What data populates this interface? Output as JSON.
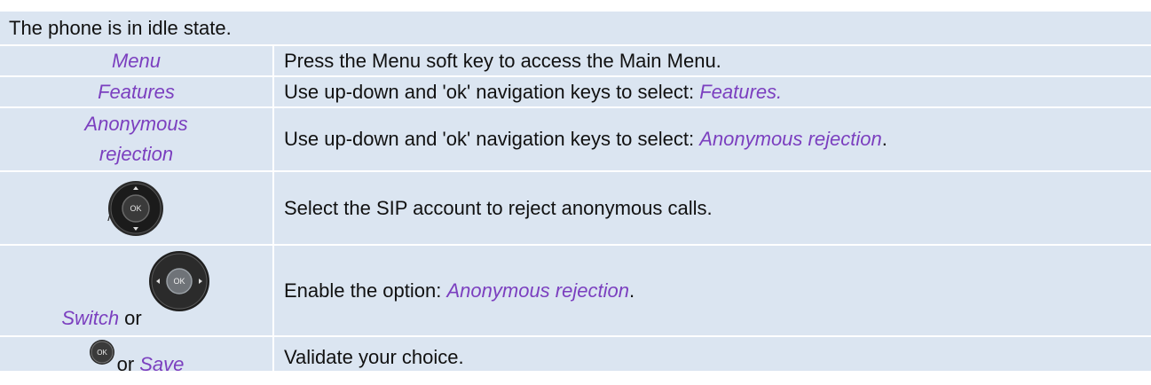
{
  "header": {
    "text": "The phone is in idle state."
  },
  "rows": [
    {
      "left": {
        "label": "Menu"
      },
      "right": {
        "text": "Press the Menu soft key to access the Main Menu."
      }
    },
    {
      "left": {
        "label": "Features"
      },
      "right": {
        "prefix": "Use up-down and 'ok' navigation keys to select:",
        "highlight": "Features."
      }
    },
    {
      "left": {
        "label_line1": "Anonymous",
        "label_line2": "rejection"
      },
      "right": {
        "prefix": "Use up-down and 'ok' navigation keys to select:",
        "highlight": "Anonymous rejection",
        "suffix": "."
      }
    },
    {
      "left": {
        "icon": "up-down-ok-navigation-key-icon",
        "slash": "/",
        "ok_text": "OK"
      },
      "right": {
        "text": "Select the SIP account to reject anonymous calls."
      }
    },
    {
      "left": {
        "label": "Switch",
        "connector": "or",
        "icon": "left-right-ok-navigation-key-icon",
        "ok_text": "OK"
      },
      "right": {
        "prefix": "Enable the option:",
        "highlight": "Anonymous rejection",
        "suffix": "."
      }
    },
    {
      "left": {
        "icon": "ok-key-icon",
        "ok_text": "OK",
        "connector": "or",
        "label": "Save"
      },
      "right": {
        "text": "Validate your choice."
      }
    }
  ],
  "colors": {
    "cell_background": "#dbe5f1",
    "highlight_text": "#7b3fbf",
    "body_text": "#111111"
  }
}
